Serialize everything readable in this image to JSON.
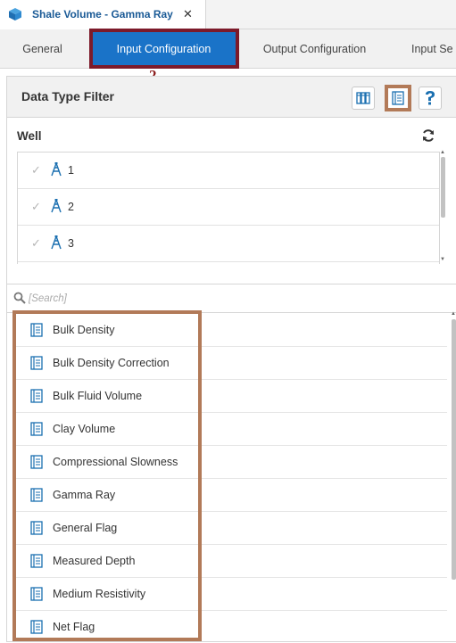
{
  "document_tab": {
    "title": "Shale Volume - Gamma Ray",
    "close_glyph": "✕",
    "icon": "cube-icon"
  },
  "config_tabs": [
    {
      "label": "General"
    },
    {
      "label": "Input Configuration"
    },
    {
      "label": "Output Configuration"
    },
    {
      "label": "Input Se"
    }
  ],
  "active_tab_index": 1,
  "callout_number": "2",
  "panel": {
    "title": "Data Type Filter",
    "buttons": [
      "columns-icon",
      "data-type-icon",
      "help-icon"
    ]
  },
  "well_section": {
    "label": "Well",
    "refresh_icon": "refresh-icon",
    "wells": [
      {
        "checked_glyph": "✓",
        "name": "1"
      },
      {
        "checked_glyph": "✓",
        "name": "2"
      },
      {
        "checked_glyph": "✓",
        "name": "3"
      }
    ]
  },
  "search": {
    "placeholder": "[Search]",
    "value": ""
  },
  "data_types": [
    "Bulk Density",
    "Bulk Density Correction",
    "Bulk Fluid Volume",
    "Clay Volume",
    "Compressional Slowness",
    "Gamma Ray",
    "General Flag",
    "Measured Depth",
    "Medium Resistivity",
    "Net Flag"
  ],
  "colors": {
    "accent": "#1a73c8",
    "title_blue": "#1a5a96",
    "highlight_red": "#7c1a2a",
    "highlight_brown": "#b27a58",
    "icon_blue": "#1a6fb0"
  }
}
